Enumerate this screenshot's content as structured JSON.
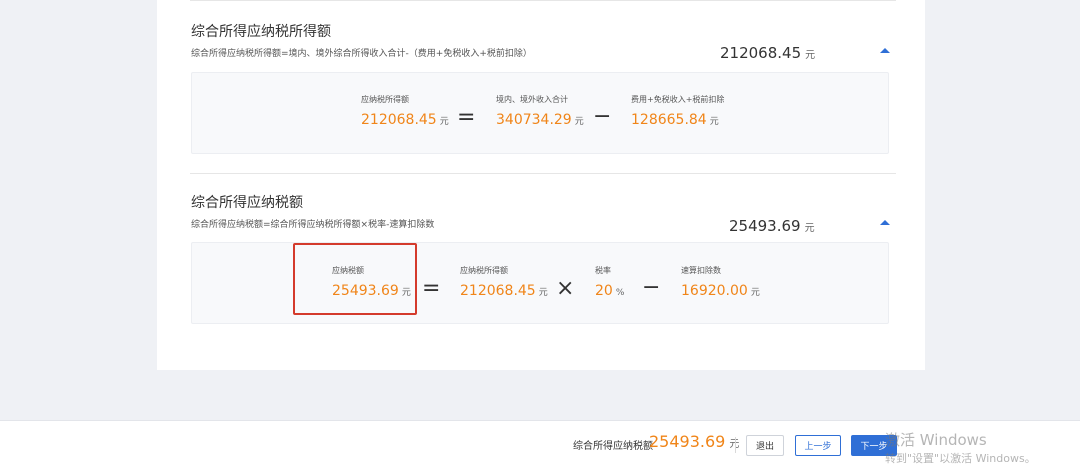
{
  "section1": {
    "title": "综合所得应纳税所得额",
    "formula": "综合所得应纳税所得额=境内、境外综合所得收入合计-（费用+免税收入+税前扣除）",
    "total": "212068.45",
    "unit": "元",
    "terms": [
      {
        "label": "应纳税所得额",
        "value": "212068.45",
        "unit": "元"
      },
      {
        "label": "境内、境外收入合计",
        "value": "340734.29",
        "unit": "元"
      },
      {
        "label": "费用+免税收入+税前扣除",
        "value": "128665.84",
        "unit": "元"
      }
    ],
    "ops": [
      "=",
      "−"
    ]
  },
  "section2": {
    "title": "综合所得应纳税额",
    "formula": "综合所得应纳税额=综合所得应纳税所得额×税率-速算扣除数",
    "total": "25493.69",
    "unit": "元",
    "terms": [
      {
        "label": "应纳税额",
        "value": "25493.69",
        "unit": "元"
      },
      {
        "label": "应纳税所得额",
        "value": "212068.45",
        "unit": "元"
      },
      {
        "label": "税率",
        "value": "20",
        "unit": "%"
      },
      {
        "label": "速算扣除数",
        "value": "16920.00",
        "unit": "元"
      }
    ],
    "ops": [
      "=",
      "×",
      "−"
    ]
  },
  "footer": {
    "label": "综合所得应纳税额",
    "value": "25493.69",
    "unit": "元",
    "exit_label": "退出",
    "prev_label": "上一步",
    "next_label": "下一步"
  },
  "watermark": {
    "line1": "激活 Windows",
    "line2": "转到\"设置\"以激活 Windows。"
  },
  "colors": {
    "accent": "#2f6fd6",
    "value": "#f08519",
    "highlight": "#d43b2c"
  }
}
